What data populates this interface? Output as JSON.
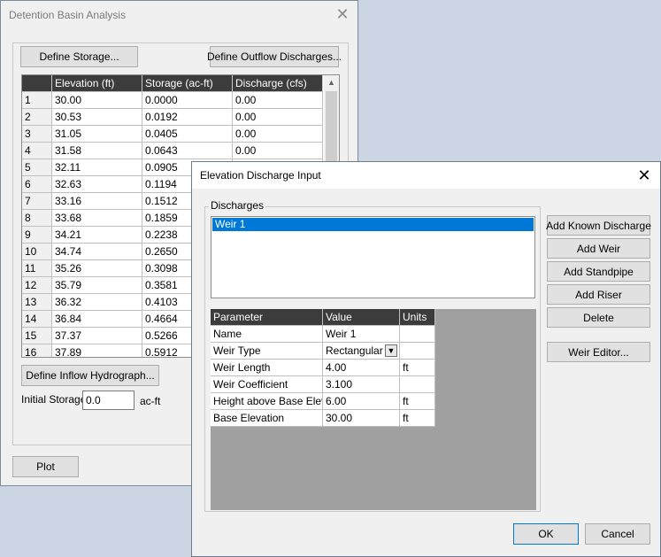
{
  "main_window": {
    "title": "Detention Basin Analysis",
    "close_glyph": "✕",
    "define_storage_label": "Define Storage...",
    "define_outflow_label": "Define Outflow Discharges...",
    "table": {
      "headers": [
        "",
        "Elevation (ft)",
        "Storage (ac-ft)",
        "Discharge (cfs)"
      ],
      "rows": [
        [
          "1",
          "30.00",
          "0.0000",
          "0.00"
        ],
        [
          "2",
          "30.53",
          "0.0192",
          "0.00"
        ],
        [
          "3",
          "31.05",
          "0.0405",
          "0.00"
        ],
        [
          "4",
          "31.58",
          "0.0643",
          "0.00"
        ],
        [
          "5",
          "32.11",
          "0.0905",
          ""
        ],
        [
          "6",
          "32.63",
          "0.1194",
          ""
        ],
        [
          "7",
          "33.16",
          "0.1512",
          ""
        ],
        [
          "8",
          "33.68",
          "0.1859",
          ""
        ],
        [
          "9",
          "34.21",
          "0.2238",
          ""
        ],
        [
          "10",
          "34.74",
          "0.2650",
          ""
        ],
        [
          "11",
          "35.26",
          "0.3098",
          ""
        ],
        [
          "12",
          "35.79",
          "0.3581",
          ""
        ],
        [
          "13",
          "36.32",
          "0.4103",
          ""
        ],
        [
          "14",
          "36.84",
          "0.4664",
          ""
        ],
        [
          "15",
          "37.37",
          "0.5266",
          ""
        ],
        [
          "16",
          "37.89",
          "0.5912",
          ""
        ]
      ]
    },
    "define_inflow_label": "Define Inflow Hydrograph...",
    "initial_storage_label": "Initial Storage:",
    "initial_storage_value": "0.0",
    "initial_storage_unit": "ac-ft",
    "plot_label": "Plot"
  },
  "dialog": {
    "title": "Elevation Discharge Input",
    "close_glyph": "✕",
    "discharges_group_label": "Discharges",
    "discharges": [
      "Weir 1"
    ],
    "selected_discharge": "Weir 1",
    "buttons": {
      "add_known": "Add Known Discharge",
      "add_weir": "Add Weir",
      "add_standpipe": "Add Standpipe",
      "add_riser": "Add Riser",
      "delete": "Delete",
      "weir_editor": "Weir Editor...",
      "ok": "OK",
      "cancel": "Cancel"
    },
    "params": {
      "headers": [
        "Parameter",
        "Value",
        "Units"
      ],
      "rows": [
        [
          "Name",
          "Weir 1",
          ""
        ],
        [
          "Weir Type",
          "Rectangular",
          ""
        ],
        [
          "Weir Length",
          "4.00",
          "ft"
        ],
        [
          "Weir Coefficient",
          "3.100",
          ""
        ],
        [
          "Height above Base Elev",
          "6.00",
          "ft"
        ],
        [
          "Base Elevation",
          "30.00",
          "ft"
        ]
      ]
    }
  }
}
